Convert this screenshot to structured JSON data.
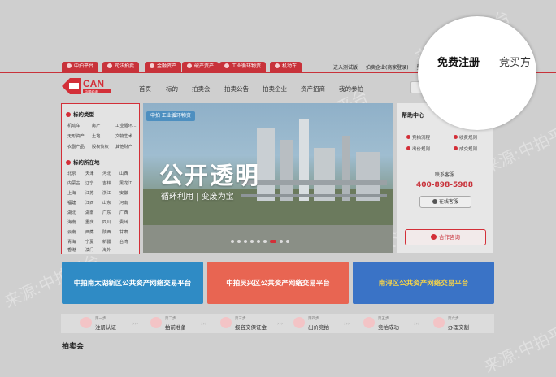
{
  "category_tabs": [
    {
      "label": "中拍平台"
    },
    {
      "label": "司法拍卖"
    },
    {
      "label": "金融资产"
    },
    {
      "label": "破产资产"
    },
    {
      "label": "工业循环物资"
    },
    {
      "label": "机动车"
    }
  ],
  "top_links": [
    "进入测试版",
    "拍卖企业(商家登录)",
    "登"
  ],
  "nav": [
    "首页",
    "标的",
    "拍卖会",
    "拍卖公告",
    "拍卖企业",
    "资产招商",
    "我的参拍"
  ],
  "logo": {
    "text": "CAN",
    "sub": "中国拍卖"
  },
  "sidebar": {
    "type_title": "标的类型",
    "types": [
      "机动车",
      "房产",
      "工业循环...",
      "无形资产",
      "土地",
      "文物艺术...",
      "农副产品",
      "股权债权",
      "其他财产"
    ],
    "region_title": "标的所在地",
    "regions": [
      "北京",
      "天津",
      "河北",
      "山西",
      "内蒙古",
      "辽宁",
      "吉林",
      "黑龙江",
      "上海",
      "江苏",
      "浙江",
      "安徽",
      "福建",
      "江西",
      "山东",
      "河南",
      "湖北",
      "湖南",
      "广东",
      "广西",
      "海南",
      "重庆",
      "四川",
      "贵州",
      "云南",
      "西藏",
      "陕西",
      "甘肃",
      "青海",
      "宁夏",
      "新疆",
      "台湾",
      "香港",
      "澳门",
      "海外"
    ]
  },
  "banner": {
    "tag": "中拍·工业循环物资",
    "title": "公开透明",
    "subtitle": "循环利用 | 变废为宝"
  },
  "help": {
    "title": "帮助中心",
    "links": [
      "竞拍流程",
      "收费规则",
      "出价规则",
      "成交规则"
    ],
    "service_label": "联系客服",
    "phone": "400-898-5988",
    "online_button": "在线客服",
    "cooperate_button": "合作咨询"
  },
  "cards": [
    {
      "text": "中拍南太湖新区公共资产网络交易平台",
      "color": "#2f8bc5"
    },
    {
      "text": "中拍吴兴区公共资产网络交易平台",
      "color": "#e86552"
    },
    {
      "text": "南浔区公共资产网络交易平台",
      "color": "#3a73c6"
    }
  ],
  "steps": [
    {
      "n": "第一步",
      "t": "注册认证"
    },
    {
      "n": "第二步",
      "t": "拍前准备"
    },
    {
      "n": "第三步",
      "t": "报名交保证金"
    },
    {
      "n": "第四步",
      "t": "出价竞拍"
    },
    {
      "n": "第五步",
      "t": "竞拍成功"
    },
    {
      "n": "第六步",
      "t": "办理交割"
    }
  ],
  "section_title": "拍卖会",
  "magnifier": {
    "register": "免费注册",
    "buyer": "竞买方"
  },
  "watermark": "来源:中拍平台"
}
